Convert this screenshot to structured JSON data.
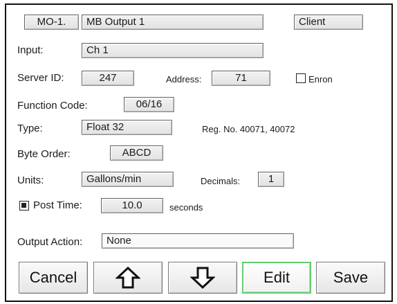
{
  "header": {
    "output_id": "MO-1.",
    "output_name": "MB Output 1",
    "mode": "Client"
  },
  "input": {
    "label": "Input:",
    "value": "Ch 1"
  },
  "server": {
    "id_label": "Server ID:",
    "id_value": "247",
    "address_label": "Address:",
    "address_value": "71",
    "enron_label": "Enron",
    "enron_checked": false
  },
  "function_code": {
    "label": "Function Code:",
    "value": "06/16"
  },
  "type": {
    "label": "Type:",
    "value": "Float 32",
    "reg_info": "Reg. No. 40071, 40072"
  },
  "byte_order": {
    "label": "Byte Order:",
    "value": "ABCD"
  },
  "units": {
    "label": "Units:",
    "value": "Gallons/min",
    "decimals_label": "Decimals:",
    "decimals_value": "1"
  },
  "post_time": {
    "label": "Post Time:",
    "checked": true,
    "value": "10.0",
    "unit": "seconds"
  },
  "output_action": {
    "label": "Output Action:",
    "value": "None"
  },
  "buttons": {
    "cancel": "Cancel",
    "up_icon": "arrow-up-icon",
    "down_icon": "arrow-down-icon",
    "edit": "Edit",
    "save": "Save"
  },
  "colors": {
    "edit_highlight": "#5fcf6d"
  }
}
